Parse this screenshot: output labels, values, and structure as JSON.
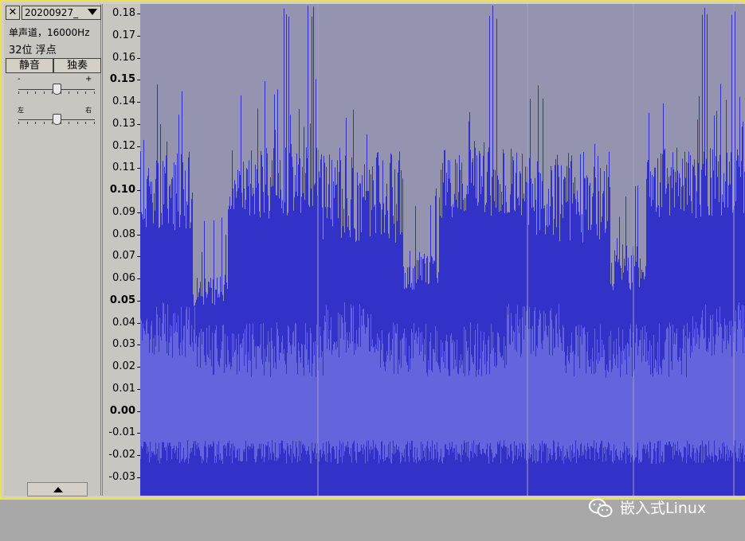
{
  "track": {
    "name": "20200927_",
    "close_glyph": "✕",
    "channel_info": "单声道，16000Hz",
    "format_info": "32位 浮点",
    "mute_label": "静音",
    "solo_label": "独奏",
    "gain_minus": "-",
    "gain_plus": "+",
    "pan_left": "左",
    "pan_right": "右",
    "gain_value": 0.5,
    "pan_value": 0.5
  },
  "ruler": {
    "labels": [
      "0.18",
      "0.17",
      "0.16",
      "0.15",
      "0.14",
      "0.13",
      "0.12",
      "0.11",
      "0.10",
      "0.09",
      "0.08",
      "0.07",
      "0.06",
      "0.05",
      "0.04",
      "0.03",
      "0.02",
      "0.01",
      "0.00",
      "-0.01",
      "-0.02",
      "-0.03"
    ],
    "bold": [
      "0.15",
      "0.10",
      "0.05",
      "0.00"
    ]
  },
  "colors": {
    "wave_bg": "#9494b0",
    "wave_peak": "#3232c8",
    "wave_rms": "#6464dc",
    "border_selected": "#e8e44a"
  },
  "watermark": {
    "icon": "wechat-icon",
    "text": "嵌入式Linux"
  }
}
